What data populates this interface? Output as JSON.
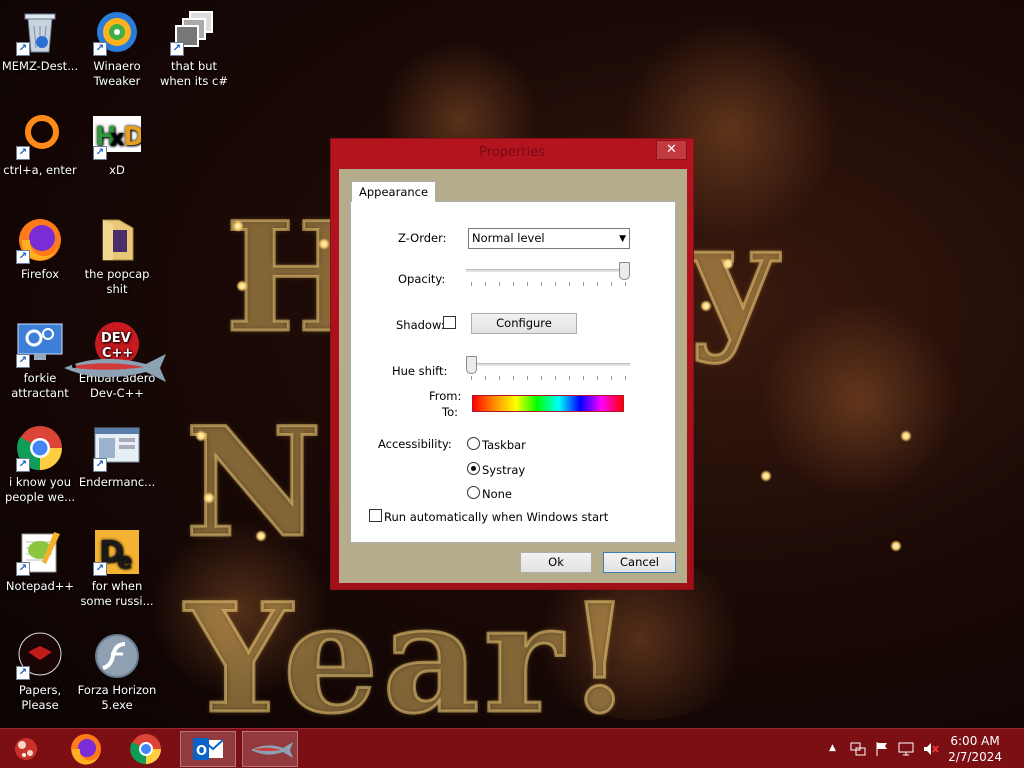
{
  "desktop": {
    "icons": [
      {
        "label": "MEMZ-Dest..."
      },
      {
        "label": "Winaero Tweaker"
      },
      {
        "label": "that but when its c#"
      },
      {
        "label": "ctrl+a, enter"
      },
      {
        "label": "xD"
      },
      {
        "label": "Firefox"
      },
      {
        "label": "the popcap shit"
      },
      {
        "label": "forkie attractant"
      },
      {
        "label": "Embarcadero Dev-C++"
      },
      {
        "label": "i know you people we..."
      },
      {
        "label": "Endermanc..."
      },
      {
        "label": "Notepad++"
      },
      {
        "label": "for when some russi..."
      },
      {
        "label": "Papers, Please"
      },
      {
        "label": "Forza Horizon 5.exe"
      }
    ],
    "wallpaper_text": {
      "line1": "Happy",
      "line2": "New Year!"
    }
  },
  "dialog": {
    "title": "Properties",
    "close_glyph": "✕",
    "tab_label": "Appearance",
    "zorder_label": "Z-Order:",
    "zorder_value": "Normal level",
    "opacity_label": "Opacity:",
    "opacity_level": 1.0,
    "shadow_label": "Shadow:",
    "shadow_checked": false,
    "configure_label": "Configure",
    "hue_label": "Hue shift:",
    "hue_level": 0.0,
    "from_label": "From:",
    "to_label": "To:",
    "accessibility_label": "Accessibility:",
    "access_options": [
      "Taskbar",
      "Systray",
      "None"
    ],
    "access_selected": "Systray",
    "autorun_label": "Run automatically when Windows start",
    "ok_label": "Ok",
    "cancel_label": "Cancel"
  },
  "taskbar": {
    "apps": [
      "start-orb",
      "firefox",
      "chrome",
      "outlook",
      "fish-app"
    ],
    "time": "6:00 AM",
    "date": "2/7/2024",
    "tray_icons": [
      "chevron-up-icon",
      "network-icon",
      "flag-icon",
      "monitor-icon",
      "volume-muted-icon"
    ]
  }
}
